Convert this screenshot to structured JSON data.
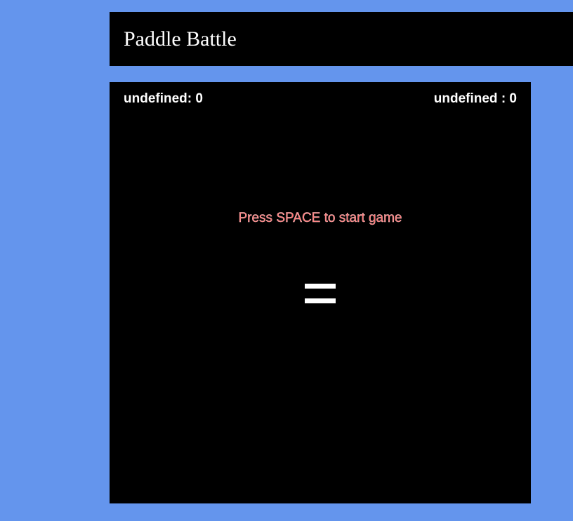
{
  "header": {
    "title": "Paddle Battle"
  },
  "game": {
    "left_score": "undefined: 0",
    "right_score": "undefined : 0",
    "message": "Press SPACE to start game"
  },
  "colors": {
    "background": "#6495ED",
    "board": "#000000",
    "message": "#ff6b6b",
    "text": "#ffffff"
  }
}
